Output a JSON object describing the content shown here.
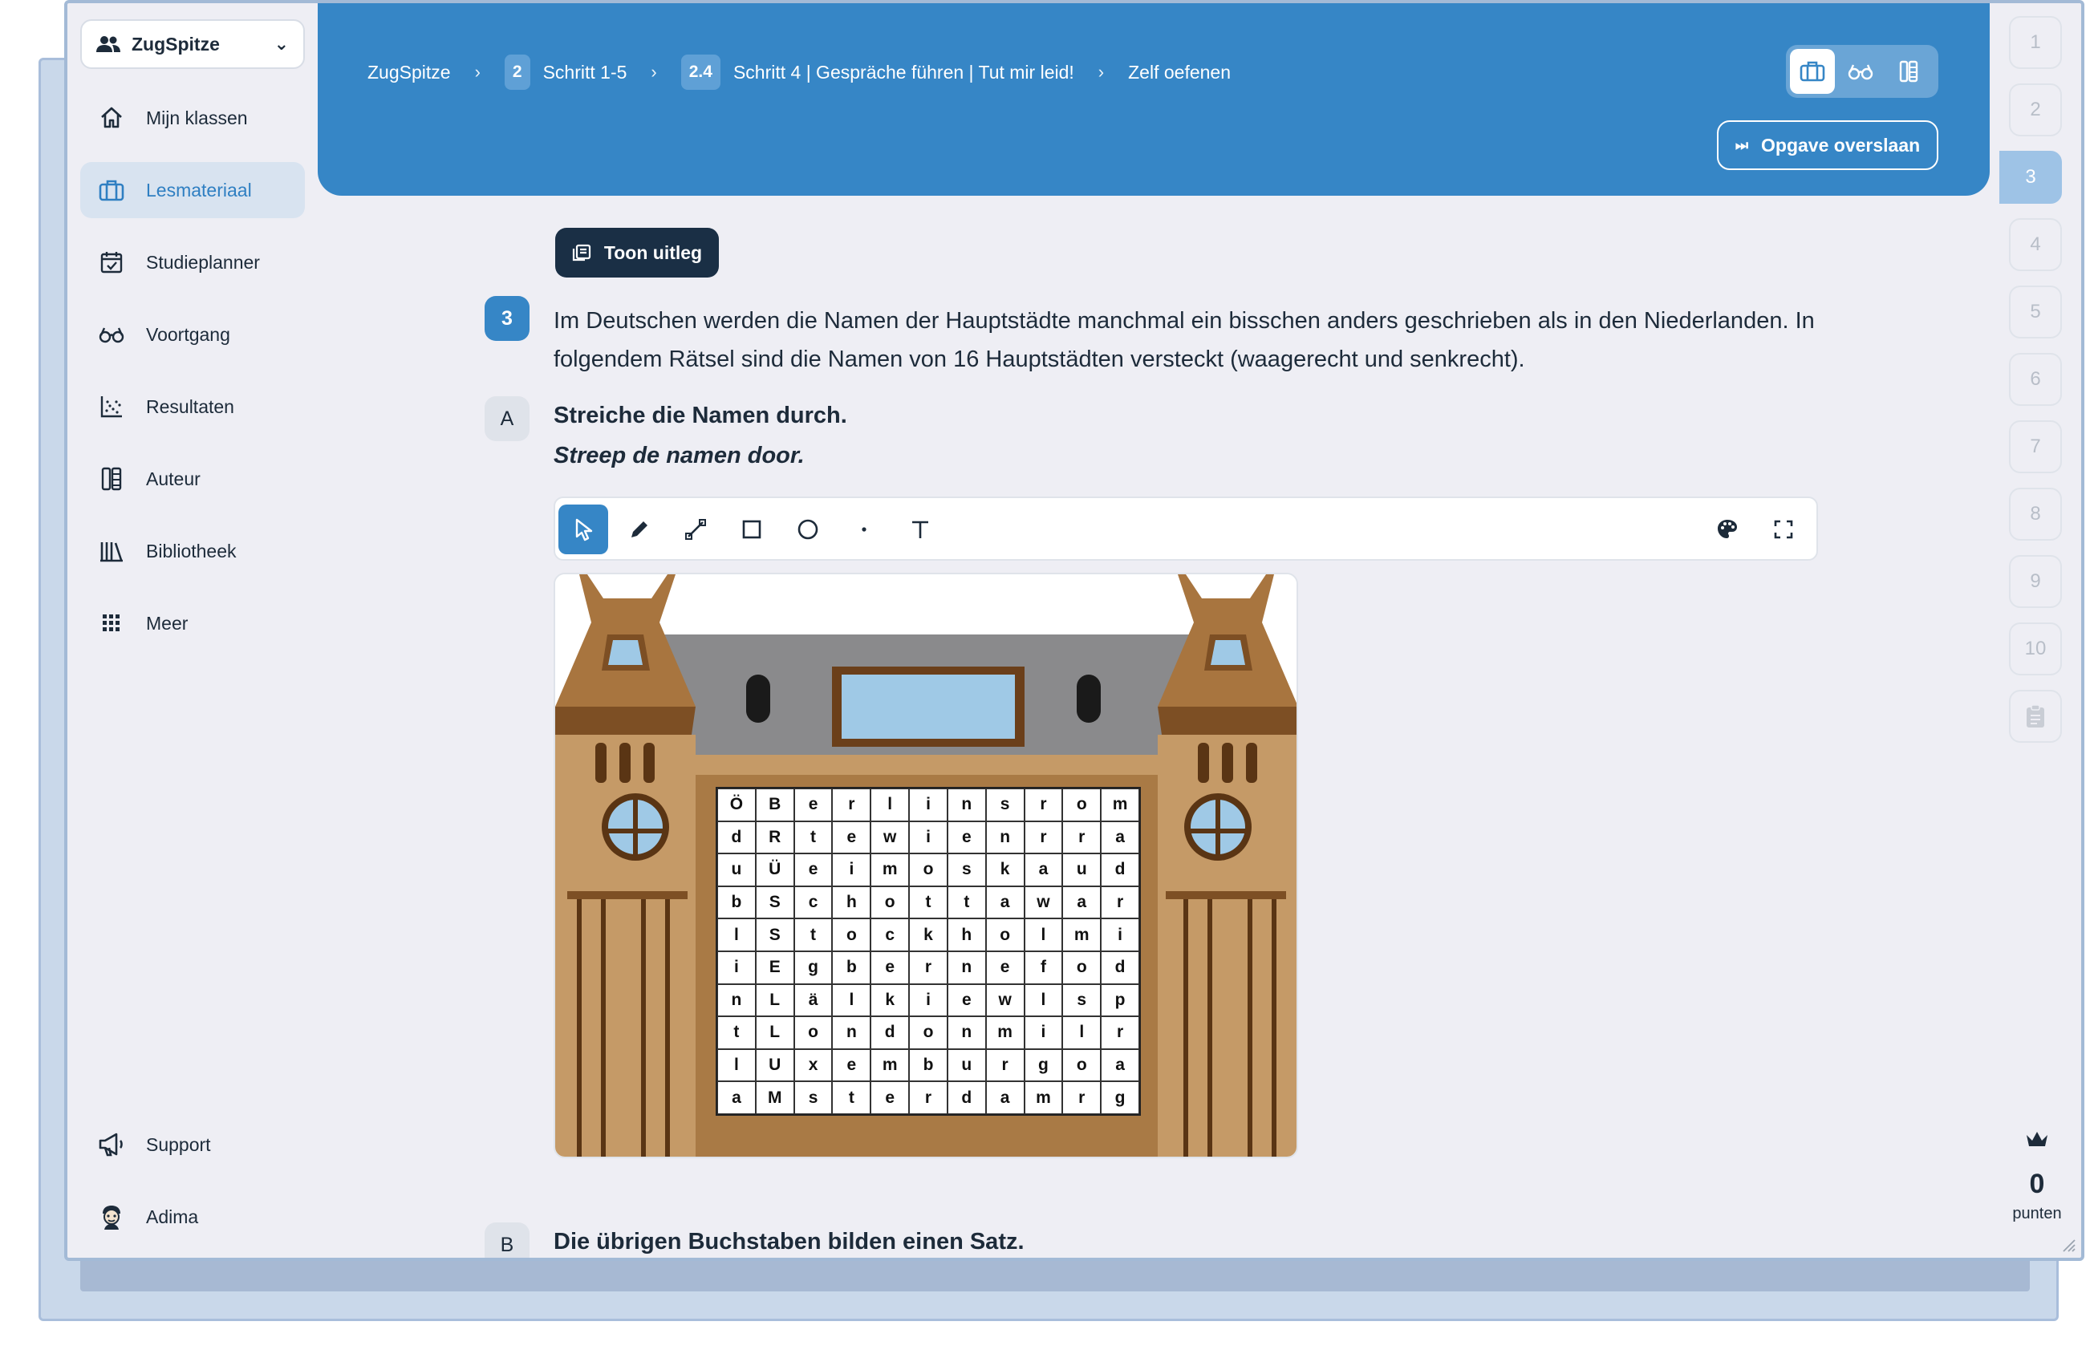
{
  "sidebar": {
    "class_select": "ZugSpitze",
    "items": [
      {
        "label": "Mijn klassen"
      },
      {
        "label": "Lesmateriaal"
      },
      {
        "label": "Studieplanner"
      },
      {
        "label": "Voortgang"
      },
      {
        "label": "Resultaten"
      },
      {
        "label": "Auteur"
      },
      {
        "label": "Bibliotheek"
      },
      {
        "label": "Meer"
      },
      {
        "label": "Support"
      },
      {
        "label": "Adima"
      }
    ],
    "active_index": 1
  },
  "header": {
    "crumbs": [
      {
        "label": "ZugSpitze"
      },
      {
        "num": "2",
        "label": "Schritt 1-5"
      },
      {
        "num": "2.4",
        "label": "Schritt 4 | Gespräche führen | Tut mir leid!"
      },
      {
        "label": "Zelf oefenen"
      }
    ],
    "skip_label": "Opgave overslaan",
    "accent": "#3686c6"
  },
  "rail": {
    "steps": [
      "1",
      "2",
      "3",
      "4",
      "5",
      "6",
      "7",
      "8",
      "9",
      "10"
    ],
    "active_step": "3",
    "points_value": "0",
    "points_label": "punten"
  },
  "main": {
    "toon_label": "Toon uitleg",
    "question_number": "3",
    "question_text": "Im Deutschen werden die Namen der Hauptstädte manchmal ein bisschen anders geschrieben als in den Niederlanden. In folgendem Rätsel sind die Namen von 16 Hauptstädten versteckt (waagerecht und senkrecht).",
    "part_a": {
      "letter": "A",
      "title": "Streiche die Namen durch.",
      "subtitle": "Streep de namen door."
    },
    "part_b": {
      "letter": "B",
      "title": "Die übrigen Buchstaben bilden einen Satz."
    },
    "tools": [
      "select-icon",
      "pen-icon",
      "line-icon",
      "rectangle-icon",
      "circle-icon",
      "dot-icon",
      "text-icon"
    ],
    "puzzle": [
      [
        "Ö",
        "B",
        "e",
        "r",
        "l",
        "i",
        "n",
        "s",
        "r",
        "o",
        "m"
      ],
      [
        "d",
        "R",
        "t",
        "e",
        "w",
        "i",
        "e",
        "n",
        "r",
        "r",
        "a"
      ],
      [
        "u",
        "Ü",
        "e",
        "i",
        "m",
        "o",
        "s",
        "k",
        "a",
        "u",
        "d"
      ],
      [
        "b",
        "S",
        "c",
        "h",
        "o",
        "t",
        "t",
        "a",
        "w",
        "a",
        "r"
      ],
      [
        "l",
        "S",
        "t",
        "o",
        "c",
        "k",
        "h",
        "o",
        "l",
        "m",
        "i"
      ],
      [
        "i",
        "E",
        "g",
        "b",
        "e",
        "r",
        "n",
        "e",
        "f",
        "o",
        "d"
      ],
      [
        "n",
        "L",
        "ä",
        "l",
        "k",
        "i",
        "e",
        "w",
        "l",
        "s",
        "p"
      ],
      [
        "t",
        "L",
        "o",
        "n",
        "d",
        "o",
        "n",
        "m",
        "i",
        "l",
        "r"
      ],
      [
        "l",
        "U",
        "x",
        "e",
        "m",
        "b",
        "u",
        "r",
        "g",
        "o",
        "a"
      ],
      [
        "a",
        "M",
        "s",
        "t",
        "e",
        "r",
        "d",
        "a",
        "m",
        "r",
        "g"
      ]
    ]
  }
}
